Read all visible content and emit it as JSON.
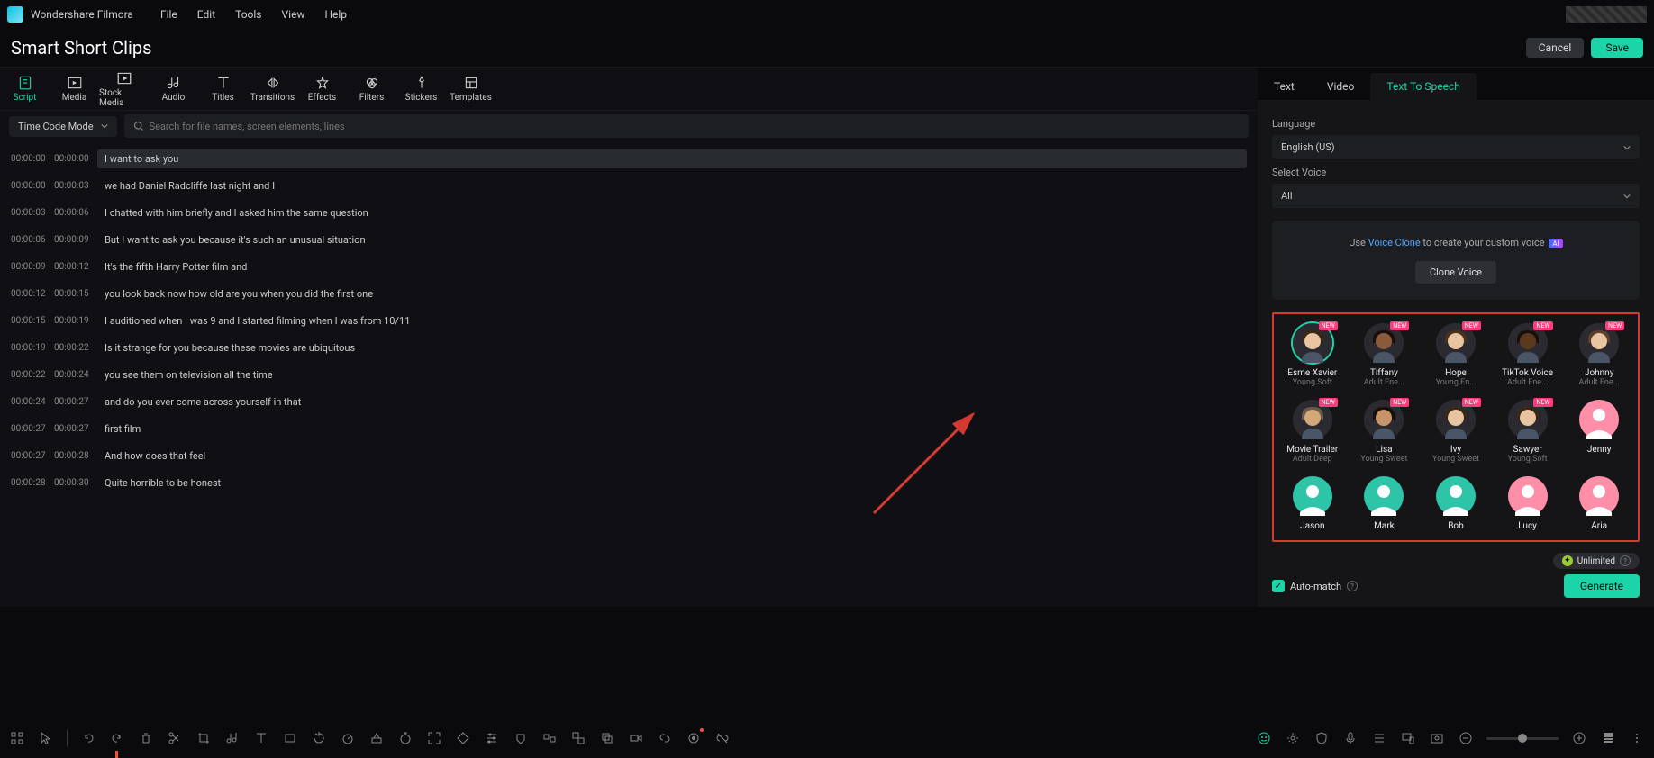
{
  "app": {
    "name": "Wondershare Filmora"
  },
  "menu": [
    "File",
    "Edit",
    "Tools",
    "View",
    "Help"
  ],
  "page_title": "Smart Short Clips",
  "buttons": {
    "cancel": "Cancel",
    "save": "Save"
  },
  "toolbar": [
    {
      "label": "Script",
      "icon": "script-icon",
      "active": true
    },
    {
      "label": "Media",
      "icon": "media-icon"
    },
    {
      "label": "Stock Media",
      "icon": "stock-icon"
    },
    {
      "label": "Audio",
      "icon": "audio-icon"
    },
    {
      "label": "Titles",
      "icon": "titles-icon"
    },
    {
      "label": "Transitions",
      "icon": "transitions-icon"
    },
    {
      "label": "Effects",
      "icon": "effects-icon"
    },
    {
      "label": "Filters",
      "icon": "filters-icon"
    },
    {
      "label": "Stickers",
      "icon": "stickers-icon"
    },
    {
      "label": "Templates",
      "icon": "templates-icon"
    }
  ],
  "mode": "Time Code Mode",
  "search_placeholder": "Search for file names, screen elements, lines",
  "script": [
    {
      "t1": "00:00:00",
      "t2": "00:00:00",
      "text": "I want to ask you",
      "selected": true
    },
    {
      "t1": "00:00:00",
      "t2": "00:00:03",
      "text": "we had Daniel Radcliffe last night and I"
    },
    {
      "t1": "00:00:03",
      "t2": "00:00:06",
      "text": "I chatted with him briefly and I asked him the same question"
    },
    {
      "t1": "00:00:06",
      "t2": "00:00:09",
      "text": "But I want to ask you because it's such an unusual situation"
    },
    {
      "t1": "00:00:09",
      "t2": "00:00:12",
      "text": "It's the fifth Harry Potter film and"
    },
    {
      "t1": "00:00:12",
      "t2": "00:00:15",
      "text": "you look back now how old are you when you did the first one"
    },
    {
      "t1": "00:00:15",
      "t2": "00:00:19",
      "text": "I auditioned when I was 9 and I started filming when I was from 10/11"
    },
    {
      "t1": "00:00:19",
      "t2": "00:00:22",
      "text": "Is it strange for you because these movies are ubiquitous"
    },
    {
      "t1": "00:00:22",
      "t2": "00:00:24",
      "text": "you see them on television all the time"
    },
    {
      "t1": "00:00:24",
      "t2": "00:00:27",
      "text": "and do you ever come across yourself in that"
    },
    {
      "t1": "00:00:27",
      "t2": "00:00:27",
      "text": "first film"
    },
    {
      "t1": "00:00:27",
      "t2": "00:00:28",
      "text": "And how does that feel"
    },
    {
      "t1": "00:00:28",
      "t2": "00:00:30",
      "text": "Quite horrible to be honest"
    }
  ],
  "right_tabs": [
    "Text",
    "Video",
    "Text To Speech"
  ],
  "language_label": "Language",
  "language_value": "English (US)",
  "select_voice_label": "Select Voice",
  "voice_filter": "All",
  "clone_text_pre": "Use ",
  "clone_link": "Voice Clone",
  "clone_text_post": " to create your custom voice",
  "clone_btn": "Clone Voice",
  "voices": [
    {
      "name": "Esme Xavier",
      "tag": "Young Soft",
      "new": true,
      "type": "photo-f1",
      "selected": true
    },
    {
      "name": "Tiffany",
      "tag": "Adult Ene...",
      "new": true,
      "type": "photo-f2"
    },
    {
      "name": "Hope",
      "tag": "Young En...",
      "new": true,
      "type": "photo-f3"
    },
    {
      "name": "TikTok Voice",
      "tag": "Adult Ene...",
      "new": true,
      "type": "photo-m1"
    },
    {
      "name": "Johnny",
      "tag": "Adult Ene...",
      "new": true,
      "type": "photo-m2"
    },
    {
      "name": "Movie Trailer",
      "tag": "Adult Deep",
      "new": true,
      "type": "photo-m3"
    },
    {
      "name": "Lisa",
      "tag": "Young Sweet",
      "new": true,
      "type": "photo-f4"
    },
    {
      "name": "Ivy",
      "tag": "Young Sweet",
      "new": true,
      "type": "photo-f5"
    },
    {
      "name": "Sawyer",
      "tag": "Young Soft",
      "new": true,
      "type": "photo-m4"
    },
    {
      "name": "Jenny",
      "tag": "",
      "type": "generic-f"
    },
    {
      "name": "Jason",
      "tag": "",
      "type": "generic-m"
    },
    {
      "name": "Mark",
      "tag": "",
      "type": "generic-m"
    },
    {
      "name": "Bob",
      "tag": "",
      "type": "generic-m"
    },
    {
      "name": "Lucy",
      "tag": "",
      "type": "generic-f"
    },
    {
      "name": "Aria",
      "tag": "",
      "type": "generic-f"
    }
  ],
  "unlimited": "Unlimited",
  "auto_match": "Auto-match",
  "generate": "Generate",
  "ai_badge": "AI",
  "new_label": "NEW"
}
